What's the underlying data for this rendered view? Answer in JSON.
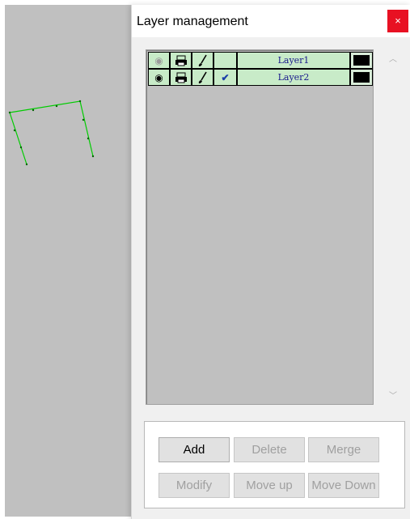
{
  "dialog": {
    "title": "Layer management",
    "close_label": "×"
  },
  "layers": [
    {
      "name": "Layer1",
      "visible": false,
      "active": false,
      "visibility_icon": "eye-icon",
      "print_icon": "printer-icon",
      "edit_icon": "brush-icon",
      "color": "#000000"
    },
    {
      "name": "Layer2",
      "visible": true,
      "active": true,
      "visibility_icon": "eye-icon",
      "print_icon": "printer-icon",
      "edit_icon": "brush-icon",
      "active_mark": "✔",
      "color": "#000000"
    }
  ],
  "buttons": {
    "add": "Add",
    "delete": "Delete",
    "merge": "Merge",
    "modify": "Modify",
    "move_up": "Move up",
    "move_down": "Move Down"
  },
  "colors": {
    "canvas_background": "#c0c0c0",
    "layer_row_background": "#c8ebc8",
    "drawing_stroke": "#00cc00",
    "close_button": "#e81123"
  }
}
